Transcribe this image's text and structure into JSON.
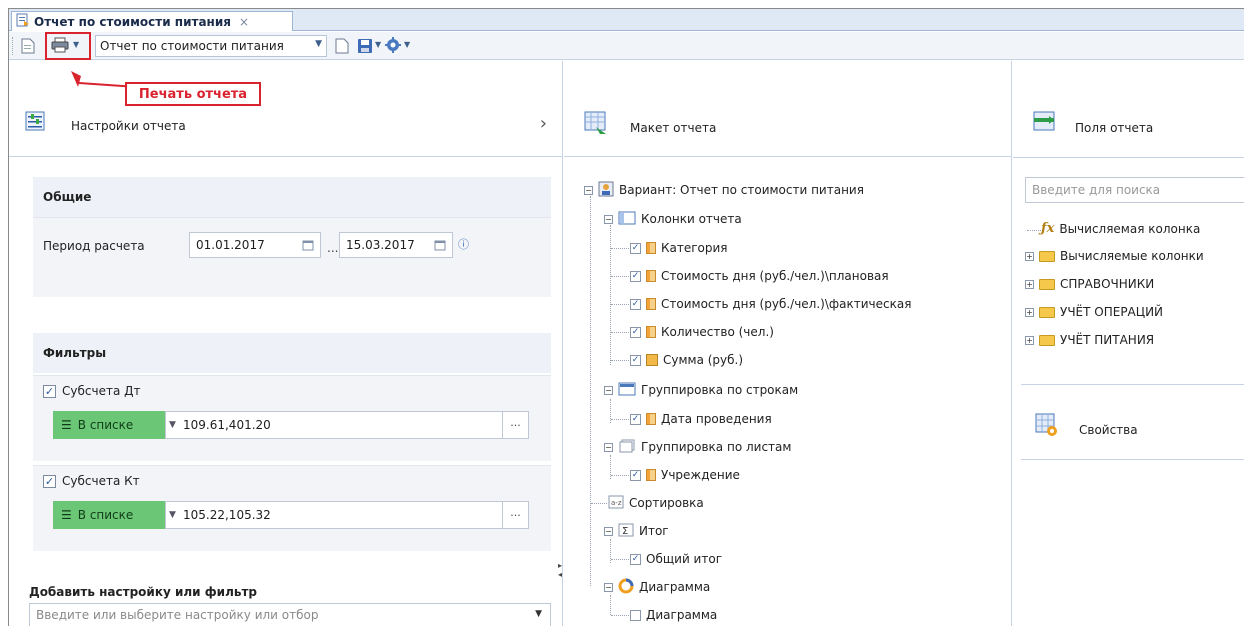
{
  "tab": {
    "title": "Отчет по стоимости питания",
    "close": "×"
  },
  "toolbar": {
    "report_select": "Отчет по стоимости питания"
  },
  "annotation": {
    "label": "Печать отчета"
  },
  "left": {
    "header_title": "Настройки отчета",
    "general": {
      "title": "Общие",
      "period_label": "Период расчета",
      "date_from": "01.01.2017",
      "date_to": "15.03.2017",
      "separator": "..."
    },
    "filters": {
      "title": "Фильтры",
      "items": [
        {
          "label": "Субсчета Дт",
          "mode": "В списке",
          "value": "109.61,401.20"
        },
        {
          "label": "Субсчета Кт",
          "mode": "В списке",
          "value": "105.22,105.32"
        }
      ]
    },
    "add": {
      "title": "Добавить настройку или фильтр",
      "placeholder": "Введите или выберите настройку или отбор"
    }
  },
  "middle": {
    "header_title": "Макет отчета",
    "tree": {
      "variant": "Вариант: Отчет по стоимости питания",
      "columns": "Колонки отчета",
      "col_items": [
        "Категория",
        "Стоимость дня (руб./чел.)\\плановая",
        "Стоимость дня (руб./чел.)\\фактическая",
        "Количество (чел.)",
        "Сумма (руб.)"
      ],
      "row_group": "Группировка по строкам",
      "row_group_item": "Дата проведения",
      "sheet_group": "Группировка по листам",
      "sheet_group_item": "Учреждение",
      "sort": "Сортировка",
      "total": "Итог",
      "total_item": "Общий итог",
      "chart": "Диаграмма",
      "chart_item": "Диаграмма"
    }
  },
  "right": {
    "header_title": "Поля отчета",
    "search_placeholder": "Введите для поиска",
    "fields": [
      "Вычисляемая колонка",
      "Вычисляемые колонки",
      "СПРАВОЧНИКИ",
      "УЧЁТ ОПЕРАЦИЙ",
      "УЧЁТ ПИТАНИЯ"
    ],
    "properties_title": "Свойства"
  }
}
